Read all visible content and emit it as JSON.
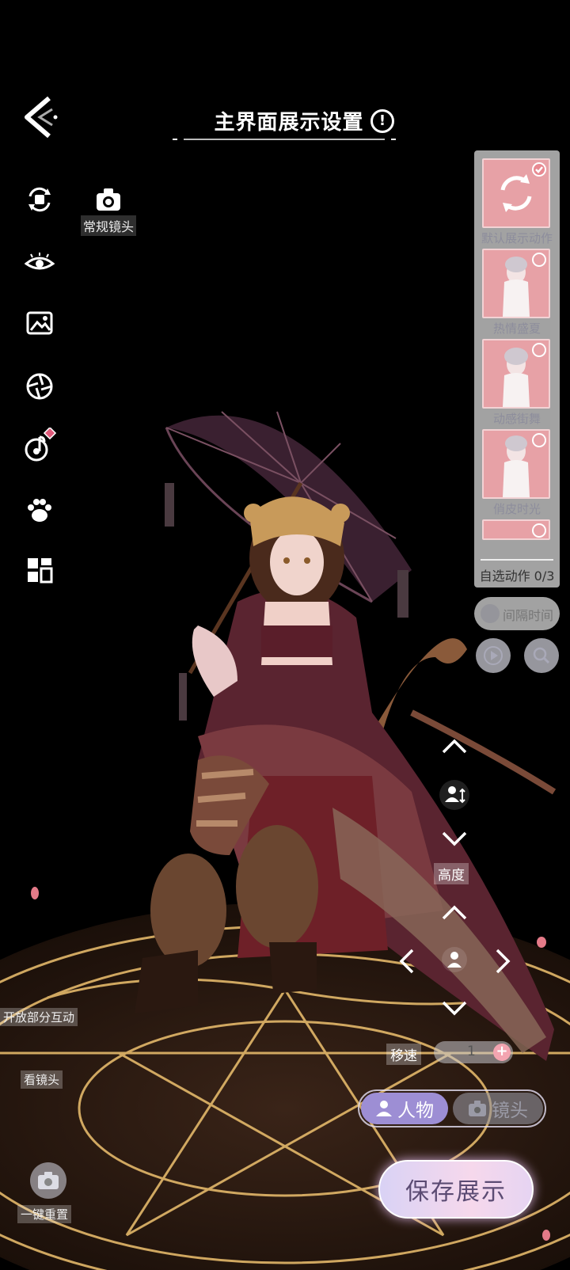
{
  "header": {
    "title": "主界面展示设置",
    "info_glyph": "!"
  },
  "left_toolbar": {
    "icons": [
      "swap-outfit-icon",
      "eye-icon",
      "image-icon",
      "aperture-icon",
      "music-icon",
      "paw-icon",
      "layout-icon"
    ]
  },
  "camera_mode": {
    "label": "常规镜头"
  },
  "action_panel": {
    "items": [
      {
        "label": "默认展示动作",
        "checked": true
      },
      {
        "label": "热情盛夏",
        "checked": false
      },
      {
        "label": "动感街舞",
        "checked": false
      },
      {
        "label": "俏皮时光",
        "checked": false
      }
    ],
    "footer": "自选动作 0/3"
  },
  "interval": {
    "label": "间隔时间"
  },
  "height_control": {
    "label": "高度"
  },
  "move_control": {
    "speed_label": "移速",
    "speed_value": "1",
    "plus": "+"
  },
  "mode_switch": {
    "character": "人物",
    "camera": "镜头",
    "active": "character"
  },
  "save": {
    "label": "保存展示"
  },
  "left_labels": {
    "open_interaction": "开放部分互动",
    "view_camera": "看镜头",
    "reset": "一键重置"
  },
  "colors": {
    "accent_purple": "#9d8ed4",
    "card_pink": "#e7a1a6",
    "gold_floor": "#e3b86a"
  }
}
